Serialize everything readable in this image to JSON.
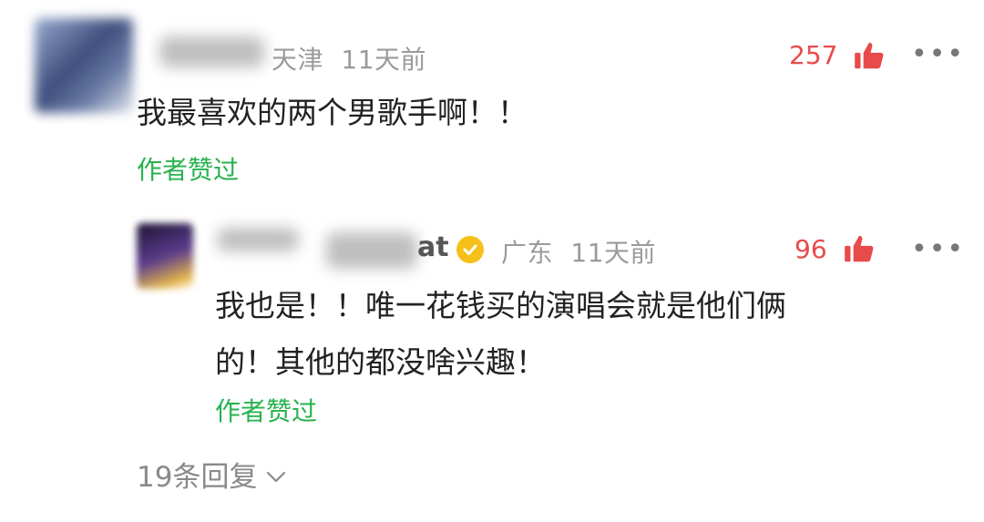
{
  "comment": {
    "location": "天津",
    "time": "11天前",
    "likes": "257",
    "text": "我最喜欢的两个男歌手啊！！",
    "author_liked": "作者赞过"
  },
  "reply": {
    "name_suffix": "at",
    "location": "广东",
    "time": "11天前",
    "likes": "96",
    "text_line1": "我也是！！唯一花钱买的演唱会就是他们俩",
    "text_line2": "的！其他的都没啥兴趣！",
    "author_liked": "作者赞过"
  },
  "replies_toggle": {
    "label": "19条回复"
  },
  "icons": {
    "like": "thumbs-up-icon",
    "more": "more-icon",
    "verified": "verified-badge-icon",
    "expand": "chevron-down-icon"
  },
  "colors": {
    "like_red": "#e84b4b",
    "author_green": "#27b24e",
    "verified_gold": "#f5c01a"
  }
}
